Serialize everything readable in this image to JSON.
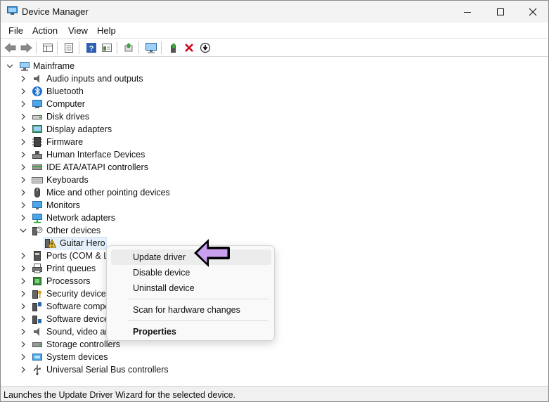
{
  "window": {
    "title": "Device Manager",
    "controls": [
      "minimize",
      "maximize",
      "close"
    ]
  },
  "menubar": {
    "items": [
      "File",
      "Action",
      "View",
      "Help"
    ]
  },
  "toolbar": {
    "buttons": [
      "back-icon",
      "forward-icon",
      "show-hide-tree-icon",
      "properties-icon",
      "help-icon",
      "view-icon",
      "update-driver-icon",
      "scan-hardware-icon",
      "enable-device-icon",
      "uninstall-icon",
      "disable-device-icon"
    ]
  },
  "tree": {
    "root": "Mainframe",
    "categories": [
      {
        "label": "Audio inputs and outputs",
        "icon": "speaker-icon",
        "expanded": false
      },
      {
        "label": "Bluetooth",
        "icon": "bluetooth-icon",
        "expanded": false
      },
      {
        "label": "Computer",
        "icon": "computer-icon",
        "expanded": false
      },
      {
        "label": "Disk drives",
        "icon": "disk-drive-icon",
        "expanded": false
      },
      {
        "label": "Display adapters",
        "icon": "display-adapter-icon",
        "expanded": false
      },
      {
        "label": "Firmware",
        "icon": "firmware-icon",
        "expanded": false
      },
      {
        "label": "Human Interface Devices",
        "icon": "hid-icon",
        "expanded": false
      },
      {
        "label": "IDE ATA/ATAPI controllers",
        "icon": "ide-controller-icon",
        "expanded": false
      },
      {
        "label": "Keyboards",
        "icon": "keyboard-icon",
        "expanded": false
      },
      {
        "label": "Mice and other pointing devices",
        "icon": "mouse-icon",
        "expanded": false
      },
      {
        "label": "Monitors",
        "icon": "monitor-icon",
        "expanded": false
      },
      {
        "label": "Network adapters",
        "icon": "network-adapter-icon",
        "expanded": false
      },
      {
        "label": "Other devices",
        "icon": "unknown-device-icon",
        "expanded": true
      },
      {
        "label": "Guitar Hero",
        "icon": "warning-device-icon",
        "child": true,
        "selected": true
      },
      {
        "label": "Ports (COM & L",
        "icon": "port-icon",
        "expanded": false
      },
      {
        "label": "Print queues",
        "icon": "printer-icon",
        "expanded": false
      },
      {
        "label": "Processors",
        "icon": "processor-icon",
        "expanded": false
      },
      {
        "label": "Security devices",
        "icon": "security-icon",
        "expanded": false
      },
      {
        "label": "Software compo",
        "icon": "software-component-icon",
        "expanded": false
      },
      {
        "label": "Software devices",
        "icon": "software-device-icon",
        "expanded": false
      },
      {
        "label": "Sound, video an",
        "icon": "sound-icon",
        "expanded": false
      },
      {
        "label": "Storage controllers",
        "icon": "storage-icon",
        "expanded": false
      },
      {
        "label": "System devices",
        "icon": "system-icon",
        "expanded": false
      },
      {
        "label": "Universal Serial Bus controllers",
        "icon": "usb-icon",
        "expanded": false
      }
    ]
  },
  "context_menu": {
    "items": [
      {
        "label": "Update driver",
        "hover": true
      },
      {
        "label": "Disable device"
      },
      {
        "label": "Uninstall device"
      },
      {
        "label": "Scan for hardware changes"
      },
      {
        "label": "Properties",
        "bold": true
      }
    ]
  },
  "status_bar": {
    "text": "Launches the Update Driver Wizard for the selected device."
  },
  "colors": {
    "accent_arrow": "#c9a0ef",
    "selection": "#e5f0fb",
    "error_red": "#d0021b"
  }
}
